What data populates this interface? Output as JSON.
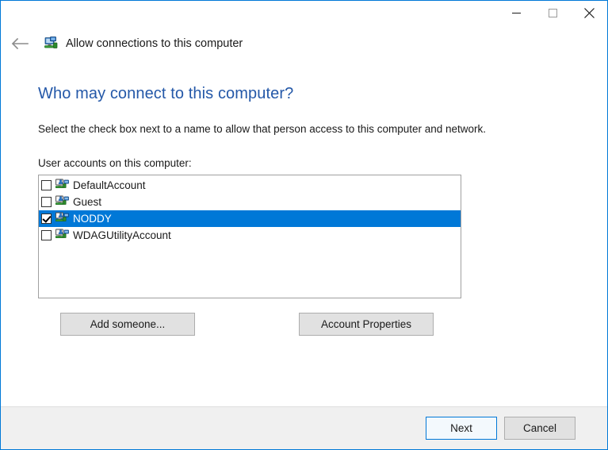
{
  "window": {
    "title": "Allow connections to this computer",
    "title_icon": "remote-desktop-icon",
    "back_icon": "back-arrow-icon",
    "controls": {
      "minimize": "minimize-icon",
      "maximize": "maximize-icon",
      "close": "close-icon"
    },
    "border_color": "#0078d7"
  },
  "page": {
    "heading": "Who may connect to this computer?",
    "heading_color": "#2458a8",
    "instructions": "Select the check box next to a name to allow that person access to this computer and network.",
    "list_label": "User accounts on this computer:"
  },
  "accounts": [
    {
      "name": "DefaultAccount",
      "checked": false,
      "selected": false
    },
    {
      "name": "Guest",
      "checked": false,
      "selected": false
    },
    {
      "name": "NODDY",
      "checked": true,
      "selected": true
    },
    {
      "name": "WDAGUtilityAccount",
      "checked": false,
      "selected": false
    }
  ],
  "selection_color": "#0078d7",
  "buttons": {
    "add_someone": "Add someone...",
    "account_properties": "Account Properties",
    "next": "Next",
    "cancel": "Cancel"
  }
}
